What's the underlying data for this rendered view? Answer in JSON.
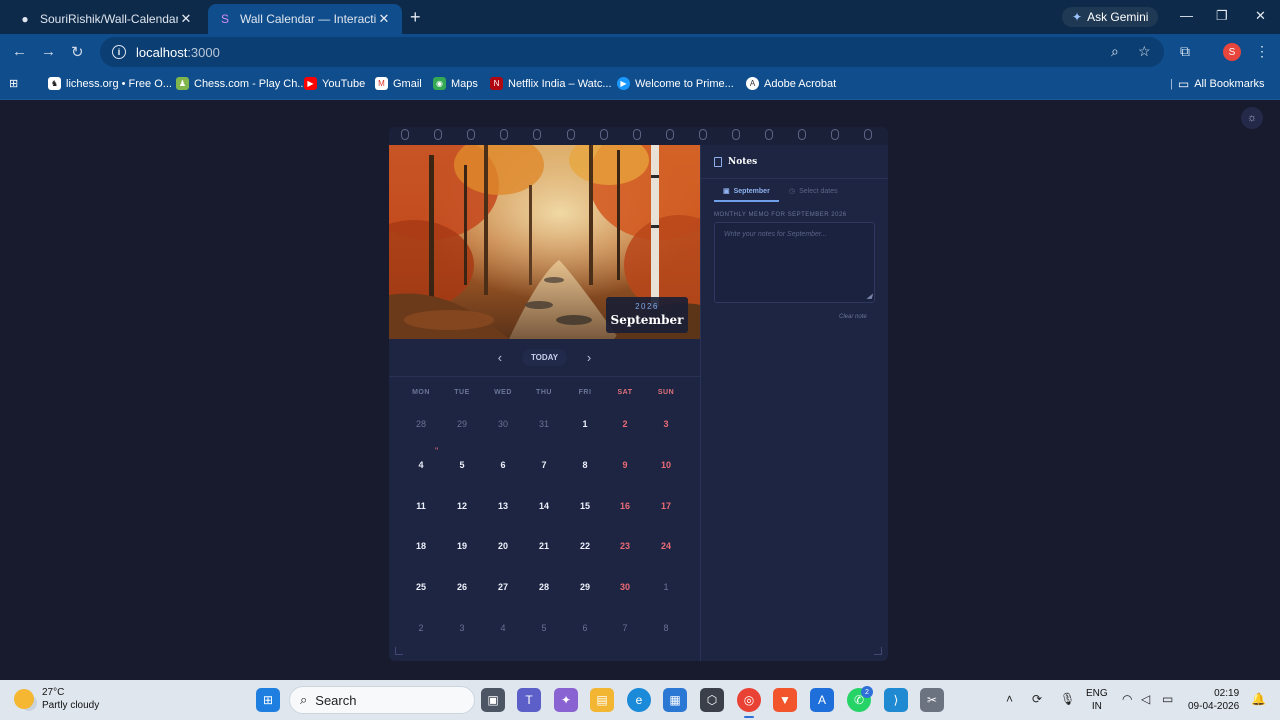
{
  "browser": {
    "tabs": [
      {
        "title": "SouriRishik/Wall-Calendar",
        "icon": "github-icon"
      },
      {
        "title": "Wall Calendar — Interactive Da",
        "icon": "site-favicon"
      }
    ],
    "ask_gemini": "Ask Gemini",
    "url_host": "localhost",
    "url_port": ":3000",
    "profile_initial": "S",
    "bookmarks": [
      {
        "label": "lichess.org • Free O..."
      },
      {
        "label": "Chess.com - Play Ch..."
      },
      {
        "label": "YouTube"
      },
      {
        "label": "Gmail"
      },
      {
        "label": "Maps"
      },
      {
        "label": "Netflix India – Watc..."
      },
      {
        "label": "Welcome to Prime..."
      },
      {
        "label": "Adobe Acrobat"
      }
    ],
    "all_bookmarks": "All Bookmarks"
  },
  "calendar": {
    "year": "2026",
    "month": "September",
    "today_label": "TODAY",
    "weekdays": [
      "MON",
      "TUE",
      "WED",
      "THU",
      "FRI",
      "SAT",
      "SUN"
    ],
    "weeks": [
      [
        "28",
        "29",
        "30",
        "31",
        "1",
        "2",
        "3"
      ],
      [
        "4",
        "5",
        "6",
        "7",
        "8",
        "9",
        "10"
      ],
      [
        "11",
        "12",
        "13",
        "14",
        "15",
        "16",
        "17"
      ],
      [
        "18",
        "19",
        "20",
        "21",
        "22",
        "23",
        "24"
      ],
      [
        "25",
        "26",
        "27",
        "28",
        "29",
        "30",
        "1"
      ],
      [
        "2",
        "3",
        "4",
        "5",
        "6",
        "7",
        "8"
      ]
    ],
    "memo_marker": "\""
  },
  "notes": {
    "title": "Notes",
    "tab_month": "September",
    "tab_select": "Select dates",
    "memo_label": "MONTHLY MEMO FOR SEPTEMBER 2026",
    "placeholder": "Write your notes for September...",
    "clear_label": "Clear note"
  },
  "taskbar": {
    "temperature": "27°C",
    "weather": "Partly cloudy",
    "search_label": "Search",
    "language_1": "ENG",
    "language_2": "IN",
    "time": "02:19",
    "date": "09-04-2026",
    "whatsapp_badge": "2"
  }
}
